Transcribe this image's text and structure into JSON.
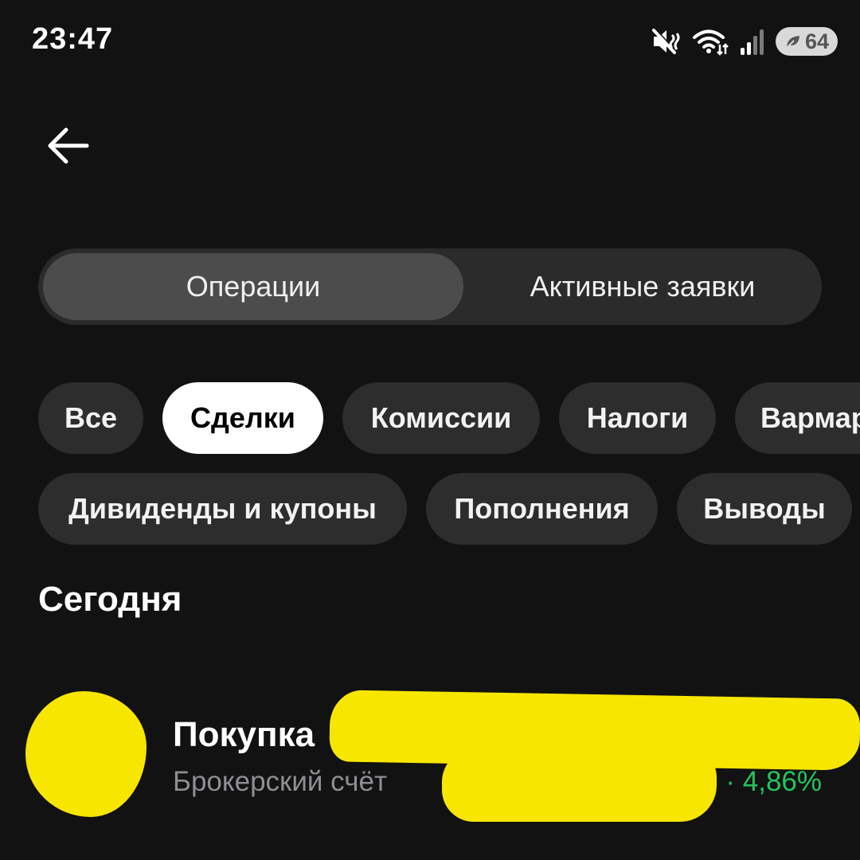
{
  "status_bar": {
    "time": "23:47",
    "battery_level": "64",
    "icons": [
      "mute-icon",
      "wifi-icon",
      "signal-icon",
      "battery-icon"
    ]
  },
  "header": {
    "back_icon": "arrow-left-icon"
  },
  "segmented_control": {
    "tabs": [
      {
        "label": "Операции",
        "active": true
      },
      {
        "label": "Активные заявки",
        "active": false
      }
    ]
  },
  "filters": {
    "chips": [
      {
        "label": "Все",
        "selected": false
      },
      {
        "label": "Сделки",
        "selected": true
      },
      {
        "label": "Комиссии",
        "selected": false
      },
      {
        "label": "Налоги",
        "selected": false
      },
      {
        "label": "Вармар",
        "selected": false
      },
      {
        "label": "Дивиденды и купоны",
        "selected": false
      },
      {
        "label": "Пополнения",
        "selected": false
      },
      {
        "label": "Выводы",
        "selected": false
      }
    ]
  },
  "sections": [
    {
      "title": "Сегодня",
      "operations": [
        {
          "title": "Покупка",
          "subtitle": "Брокерский счёт",
          "change": "· 4,86%"
        }
      ]
    }
  ],
  "colors": {
    "background": "#121212",
    "chip_background": "#2d2d2d",
    "chip_selected_background": "#ffffff",
    "segment_active": "#4c4c4c",
    "positive": "#22c55e",
    "secondary_text": "#8e8e93",
    "redaction": "#f7e600"
  }
}
